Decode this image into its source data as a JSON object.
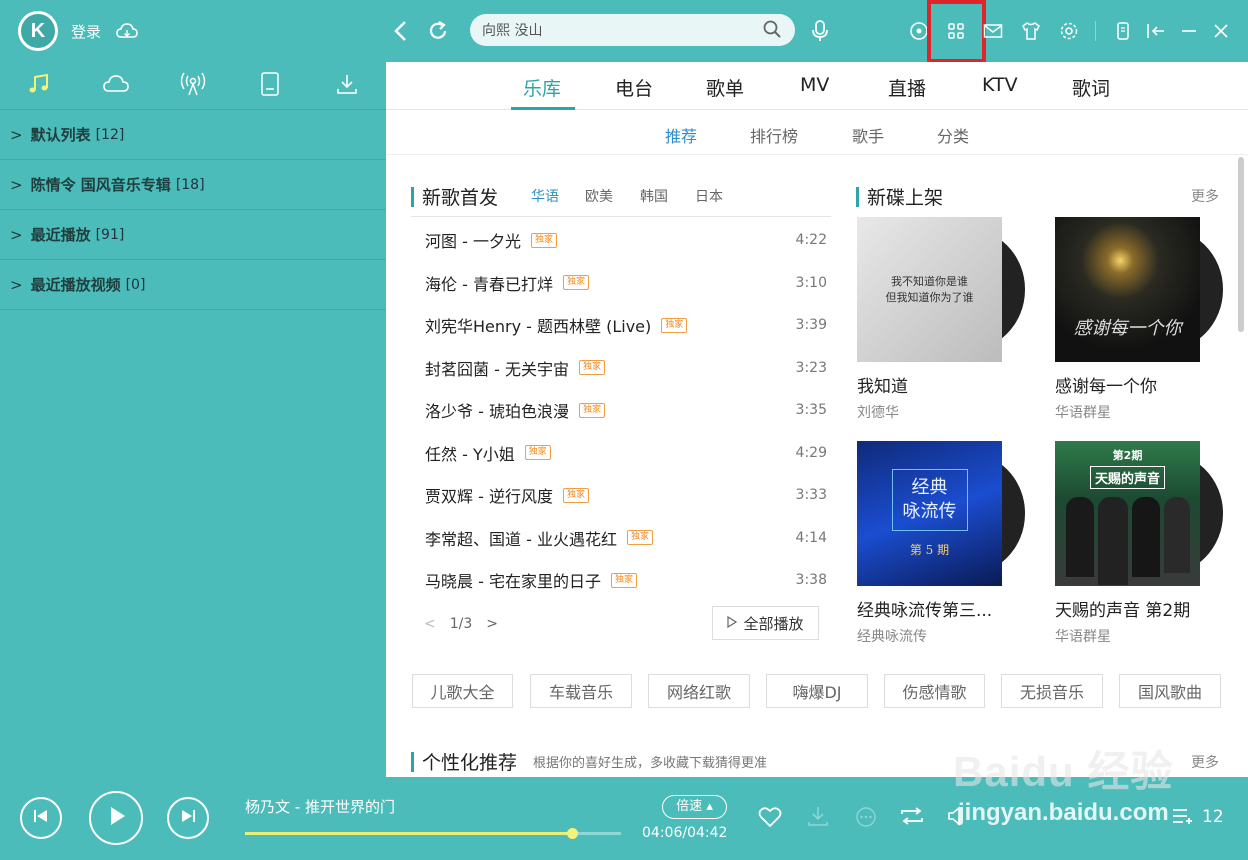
{
  "header": {
    "logo_letter": "K",
    "login_label": "登录",
    "search_value": "向熙 没山"
  },
  "sidebar": {
    "tabs": [
      "music-note-icon",
      "cloud-icon",
      "radio-icon",
      "device-icon",
      "download-icon"
    ],
    "playlists": [
      {
        "name": "默认列表",
        "count": "[12]"
      },
      {
        "name": "陈情令 国风音乐专辑",
        "count": "[18]"
      },
      {
        "name": "最近播放",
        "count": "[91]"
      },
      {
        "name": "最近播放视频",
        "count": "[0]"
      }
    ]
  },
  "main": {
    "nav_tabs": [
      "乐库",
      "电台",
      "歌单",
      "MV",
      "直播",
      "KTV",
      "歌词"
    ],
    "sub_tabs": [
      "推荐",
      "排行榜",
      "歌手",
      "分类"
    ],
    "new_songs": {
      "title": "新歌首发",
      "regions": [
        "华语",
        "欧美",
        "韩国",
        "日本"
      ],
      "badge": "独家",
      "songs": [
        {
          "name": "河图 - 一夕光",
          "dur": "4:22"
        },
        {
          "name": "海伦 - 青春已打烊",
          "dur": "3:10"
        },
        {
          "name": "刘宪华Henry - 题西林壁 (Live)",
          "dur": "3:39"
        },
        {
          "name": "封茗囧菌 - 无关宇宙",
          "dur": "3:23"
        },
        {
          "name": "洛少爷 - 琥珀色浪漫",
          "dur": "3:35"
        },
        {
          "name": "任然 - Y小姐",
          "dur": "4:29"
        },
        {
          "name": "贾双辉 - 逆行风度",
          "dur": "3:33"
        },
        {
          "name": "李常超、国道 - 业火遇花红",
          "dur": "4:14"
        },
        {
          "name": "马晓晨 - 宅在家里的日子",
          "dur": "3:38"
        }
      ],
      "page": "1/3",
      "play_all": "全部播放"
    },
    "new_albums": {
      "title": "新碟上架",
      "more": "更多",
      "albums": [
        {
          "title": "我知道",
          "artist": "刘德华",
          "cover_text": "我不知道你是谁\n但我知道你为了谁"
        },
        {
          "title": "感谢每一个你",
          "artist": "华语群星",
          "cover_text": "感谢每一个你"
        },
        {
          "title": "经典咏流传第三...",
          "artist": "经典咏流传",
          "cover_text": "经典\n咏流传",
          "cover_sub": "第 5 期"
        },
        {
          "title": "天赐的声音 第2期",
          "artist": "华语群星",
          "cover_text": "天赐的声音",
          "cover_sub": "第2期"
        }
      ]
    },
    "tags": [
      "儿歌大全",
      "车载音乐",
      "网络红歌",
      "嗨爆DJ",
      "伤感情歌",
      "无损音乐",
      "国风歌曲"
    ],
    "personal": {
      "title": "个性化推荐",
      "desc": "根据你的喜好生成，多收藏下载猜得更准",
      "more": "更多"
    }
  },
  "player": {
    "now_playing": "杨乃文 - 推开世界的门",
    "speed": "倍速",
    "time": "04:06/04:42",
    "progress": 0.87,
    "count": "12",
    "watermark": "jingyan.baidu.com",
    "watermark_logo": "Baidu 经验"
  }
}
